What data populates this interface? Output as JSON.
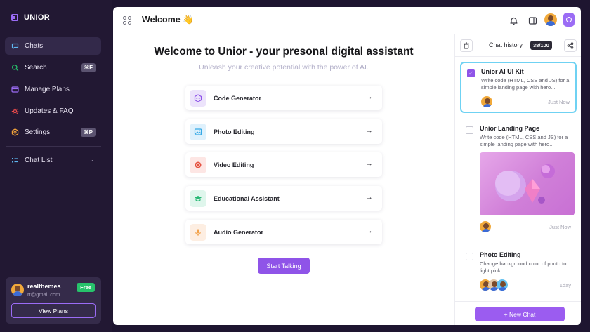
{
  "sidebar": {
    "brand": "UNIOR",
    "items": [
      {
        "label": "Chats",
        "icon": "chat-bubble-icon"
      },
      {
        "label": "Search",
        "icon": "search-icon",
        "shortcut": "⌘F"
      },
      {
        "label": "Manage Plans",
        "icon": "card-icon"
      },
      {
        "label": "Updates & FAQ",
        "icon": "gear-spark-icon"
      },
      {
        "label": "Settings",
        "icon": "settings-icon",
        "shortcut": "⌘P"
      }
    ],
    "chat_list": {
      "label": "Chat List",
      "icon": "list-icon"
    },
    "user": {
      "name": "realthemes",
      "email": "rt@gmail.com",
      "plan_badge": "Free",
      "button": "View Plans"
    }
  },
  "header": {
    "title": "Welcome 👋"
  },
  "main": {
    "heading": "Welcome to Unior - your presonal digital assistant",
    "subheading": "Unleash your creative potential with the power of AI.",
    "features": [
      {
        "label": "Code Generator",
        "icon": "code-cube-icon",
        "bg": "#ece3fb",
        "fg": "#8f54e8"
      },
      {
        "label": "Photo Editing",
        "icon": "image-icon",
        "bg": "#dff1fc",
        "fg": "#35a9e6"
      },
      {
        "label": "Video Editing",
        "icon": "video-icon",
        "bg": "#fde6e4",
        "fg": "#e5503f"
      },
      {
        "label": "Educational Assistant",
        "icon": "graduation-cap-icon",
        "bg": "#dff6ec",
        "fg": "#27b874"
      },
      {
        "label": "Audio Generator",
        "icon": "microphone-icon",
        "bg": "#fdeee2",
        "fg": "#f2a24b"
      }
    ],
    "start_button": "Start Talking"
  },
  "history": {
    "title": "Chat history",
    "count": "38/100",
    "items": [
      {
        "title": "Unior AI UI Kit",
        "text": "Write code (HTML, CSS and JS) for a simple landing page with hero...",
        "time": "Just Now",
        "checked": true
      },
      {
        "title": "Unior Landing Page",
        "text": "Write code (HTML, CSS and JS) for a simple landing page with hero...",
        "time": "Just Now",
        "checked": false
      },
      {
        "title": "Photo Editing",
        "text": "Change background color of photo to light pink.",
        "time": "1day",
        "checked": false
      }
    ],
    "new_chat": "+ New Chat"
  },
  "colors": {
    "accent": "#8f54e8",
    "sidebar_bg": "#221833",
    "selected_border": "#6fd2f3"
  }
}
